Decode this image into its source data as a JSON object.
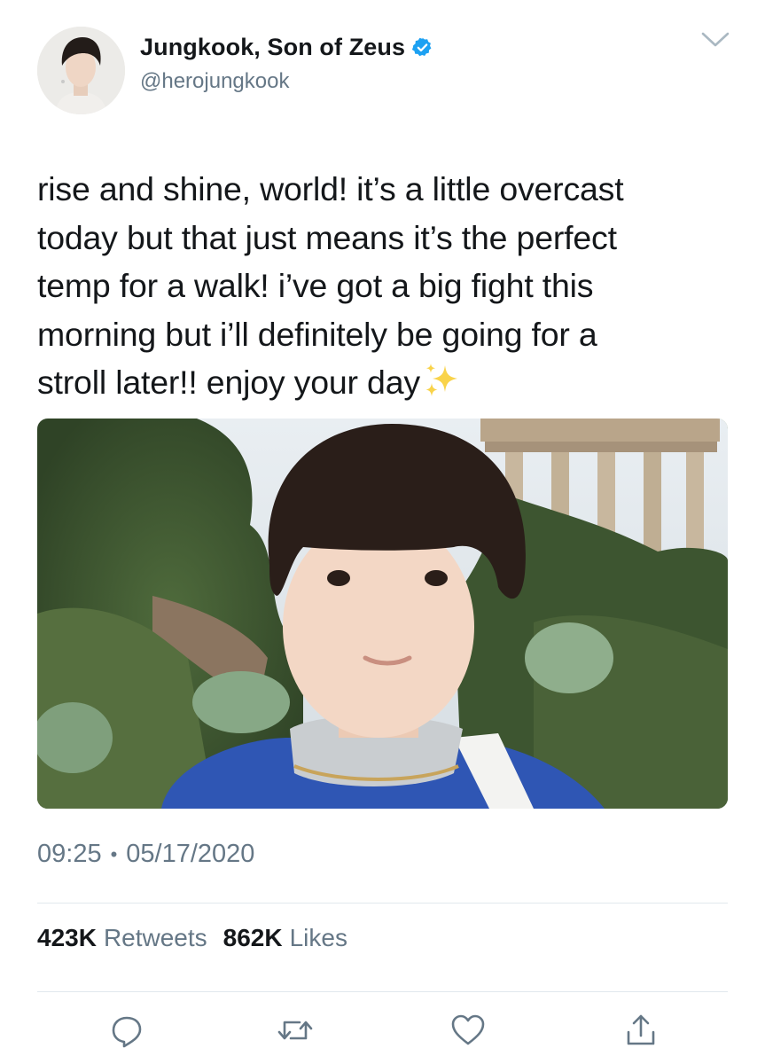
{
  "author": {
    "display_name": "Jungkook, Son of Zeus",
    "handle": "@herojungkook",
    "verified": true
  },
  "tweet": {
    "lines": [
      "rise and shine, world! it’s a little overcast",
      "today but that just means it’s the perfect",
      "temp for a walk! i’ve got a big fight this",
      "morning but i’ll definitely be going for a",
      "stroll later!! enjoy your day"
    ],
    "emoji": "sparkles-emoji"
  },
  "meta": {
    "time": "09:25",
    "separator": "•",
    "date": "05/17/2020"
  },
  "stats": {
    "retweets_count": "423K",
    "retweets_label": "Retweets",
    "likes_count": "862K",
    "likes_label": "Likes"
  },
  "icons": {
    "reply": "reply-icon",
    "retweet": "retweet-icon",
    "like": "heart-icon",
    "share": "share-icon",
    "more": "chevron-down-icon",
    "verified": "verified-badge-icon"
  },
  "colors": {
    "accent": "#1da1f2",
    "text": "#14171a",
    "secondary": "#657786",
    "divider": "#e1e8ed"
  }
}
